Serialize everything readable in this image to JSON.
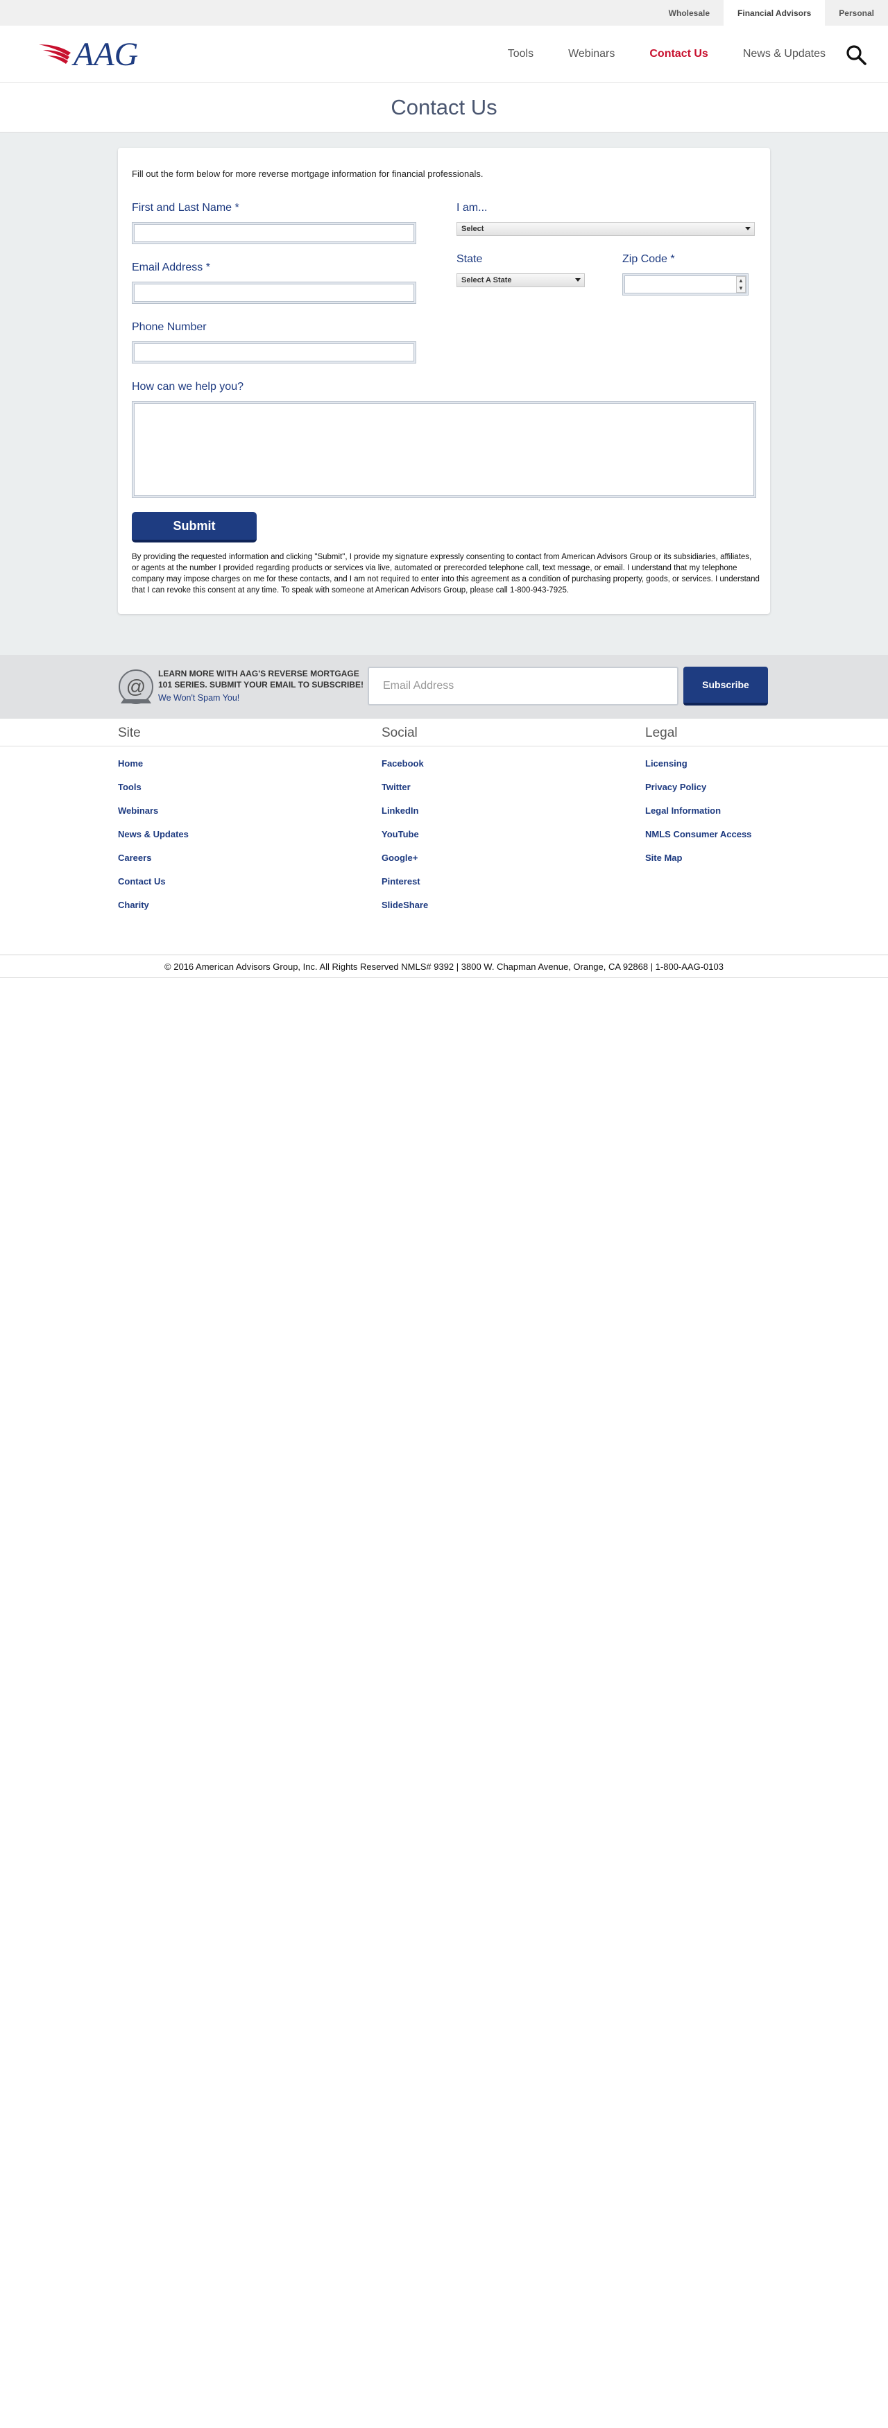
{
  "topbar": {
    "links": [
      "Wholesale",
      "Financial Advisors",
      "Personal"
    ],
    "active_index": 1
  },
  "header": {
    "logo_text": "AAG",
    "nav": [
      "Tools",
      "Webinars",
      "Contact Us",
      "News & Updates"
    ],
    "active_nav": "Contact Us"
  },
  "page": {
    "title": "Contact Us"
  },
  "form": {
    "intro": "Fill out the form below for more reverse mortgage information for financial professionals.",
    "name_label": "First and Last Name",
    "email_label": "Email Address",
    "phone_label": "Phone Number",
    "help_label": "How can we help you?",
    "iam_label": "I am...",
    "iam_value": "Select",
    "state_label": "State",
    "state_value": "Select A State",
    "zip_label": "Zip Code",
    "required_mark": "*",
    "submit_label": "Submit",
    "consent": "By providing the requested information and clicking \"Submit\", I provide my signature expressly consenting to contact from American Advisors Group or its subsidiaries, affiliates, or agents at the number I provided regarding products or services via live, automated or prerecorded telephone call, text message, or email. I understand that my telephone company may impose charges on me for these contacts, and I am not required to enter into this agreement as a condition of purchasing property, goods, or services. I understand that I can revoke this consent at any time. To speak with someone at American Advisors Group, please call 1-800-943-7925."
  },
  "newsletter": {
    "heading": "LEARN MORE WITH AAG'S REVERSE MORTGAGE 101 SERIES. SUBMIT YOUR EMAIL TO SUBSCRIBE!",
    "subtext": "We Won't Spam You!",
    "email_placeholder": "Email Address",
    "button_label": "Subscribe"
  },
  "footer": {
    "columns": [
      {
        "title": "Site",
        "links": [
          "Home",
          "Tools",
          "Webinars",
          "News & Updates",
          "Careers",
          "Contact Us",
          "Charity"
        ]
      },
      {
        "title": "Social",
        "links": [
          "Facebook",
          "Twitter",
          "LinkedIn",
          "YouTube",
          "Google+",
          "Pinterest",
          "SlideShare"
        ]
      },
      {
        "title": "Legal",
        "links": [
          "Licensing",
          "Privacy Policy",
          "Legal Information",
          "NMLS Consumer Access",
          "Site Map"
        ]
      }
    ],
    "copyright": "© 2016 American Advisors Group, Inc. All Rights Reserved NMLS# 9392 | 3800 W. Chapman Avenue, Orange, CA 92868 | 1-800-AAG-0103"
  },
  "colors": {
    "brand_blue": "#1e3c81",
    "brand_red": "#c8102e",
    "form_bg": "#ebeeef"
  }
}
